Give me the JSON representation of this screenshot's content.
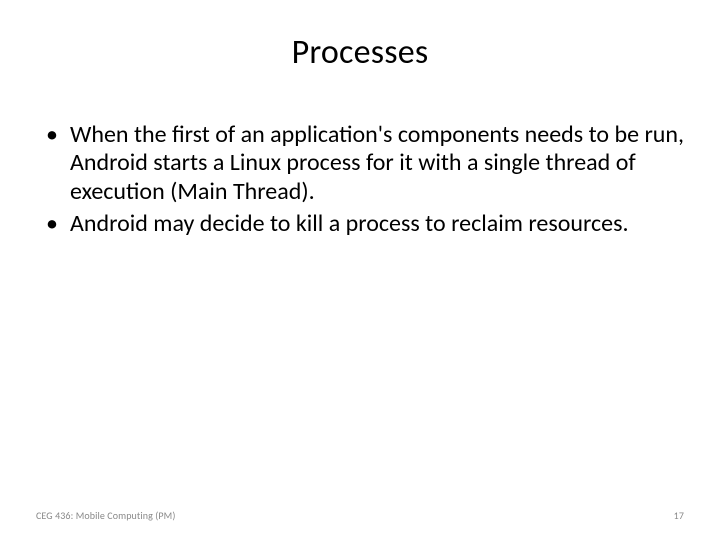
{
  "slide": {
    "title": "Processes",
    "bullets": [
      "When the first of an application's components needs to be run, Android starts a Linux process for it with a single thread of execution (Main Thread).",
      "Android may decide to kill a process to reclaim resources."
    ],
    "footer": {
      "left": "CEG 436: Mobile Computing (PM)",
      "right": "17"
    }
  }
}
